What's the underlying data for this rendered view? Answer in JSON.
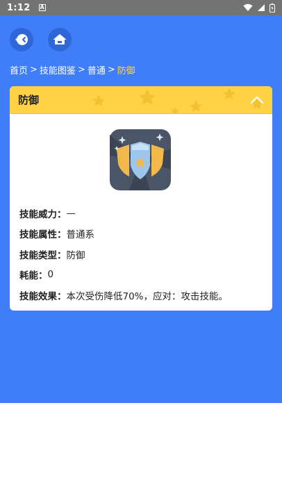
{
  "status_bar": {
    "time": "1:12",
    "notification_glyph": "A"
  },
  "nav": {
    "back_icon": "back-arrow-icon",
    "home_icon": "home-icon"
  },
  "breadcrumb": {
    "items": [
      "首页",
      "技能图鉴",
      "普通"
    ],
    "separator": ">",
    "current": "防御"
  },
  "card": {
    "title": "防御",
    "image_icon": "shield-skill-icon",
    "fields": [
      {
        "label": "技能威力：",
        "value": "—"
      },
      {
        "label": "技能属性：",
        "value": "普通系"
      },
      {
        "label": "技能类型：",
        "value": "防御"
      },
      {
        "label": "耗能：",
        "value": "0"
      },
      {
        "label": "技能效果：",
        "value": "本次受伤降低70%，应对：攻击技能。"
      }
    ]
  },
  "colors": {
    "app_background": "#3f7ef8",
    "header_yellow": "#ffd246",
    "breadcrumb_current": "#ffd84a",
    "status_bar": "#737373"
  }
}
